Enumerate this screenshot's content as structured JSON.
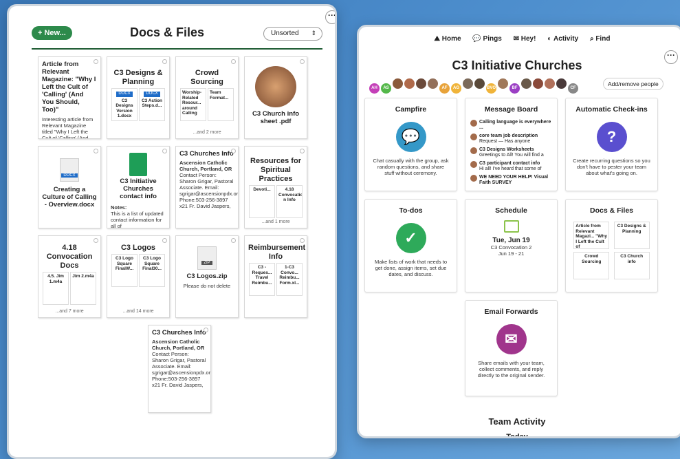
{
  "docs": {
    "new_label": "+ New...",
    "title": "Docs & Files",
    "sort": "Unsorted",
    "c1": {
      "title": "Article from Relevant Magazine: \"Why I Left the Cult of 'Calling' (And You Should, Too)\"",
      "body": "Interesting article from Relevant Magazine titled \"Why I Left the Cult of 'Calling' (And You",
      "badge": "1"
    },
    "c2": {
      "title": "C3 Designs & Planning",
      "m1": "C3 Designs Version 1.docx",
      "m2": "C3 Action Steps.d..."
    },
    "c3": {
      "title": "Crowd Sourcing",
      "m1": "Worship-Related Resour... around Calling",
      "m2": "Team Format...",
      "m3": "Storyte...",
      "m4": "Small",
      "more": "...and 2 more"
    },
    "c4": {
      "title": "C3 Church info sheet .pdf"
    },
    "c5": {
      "title": "Creating a Culture of Calling - Overview.docx",
      "docx": "DOCX"
    },
    "c6": {
      "title": "C3 Initiative Churches contact info",
      "notes": "Notes:",
      "body": "This is a list of updated contact information for all of"
    },
    "c7": {
      "title": "C3 Churches Info",
      "h": "Ascension Catholic Church, Portland, OR",
      "body": "Contact Person: Sharon Grigar, Pastoral Associate. Email: sgrigar@ascensionpdx.org Phone:503-256-3897 x21 Fr. David Jaspers,"
    },
    "c8": {
      "title": "Resources for Spiritual Practices",
      "m1": "Devoti...",
      "m2": "4.18 Convocatio n Info",
      "more": "...and 1 more"
    },
    "c9": {
      "title": "4.18 Convocation Docs",
      "m1": "4.5. Jim 1.m4a",
      "m2": "Jim 2.m4a",
      "more": "...and 7 more"
    },
    "c10": {
      "title": "C3 Logos",
      "m1": "C3 Logo Square FinalW...",
      "m2": "C3 Logo Square Final30...",
      "more": "...and 14 more"
    },
    "c11": {
      "title": "C3 Logos.zip",
      "zip": "ZIP",
      "body": "Please do not delete"
    },
    "c12": {
      "title": "Reimbursement Info",
      "m1": "C3 - Reques... Travel Reimbu...",
      "m2": "1-C3 Convo... Reimbu... Form.xl..."
    },
    "c13": {
      "title": "C3 Churches Info",
      "h": "Ascension Catholic Church, Portland, OR",
      "body": "Contact Person: Sharon Grigar, Pastoral Associate. Email: sgrigar@ascensionpdx.org Phone:503-256-3897 x21 Fr. David Jaspers,"
    }
  },
  "nav": {
    "home": "Home",
    "pings": "Pings",
    "hey": "Hey!",
    "activity": "Activity",
    "find": "Find",
    "hey_count": "1"
  },
  "project": {
    "title": "C3 Initiative Churches",
    "add": "Add/remove people",
    "avatars": [
      {
        "t": "AH",
        "c": "#c43fb8"
      },
      {
        "t": "AS",
        "c": "#54b84a"
      },
      {
        "t": "",
        "c": "#8a5a3b"
      },
      {
        "t": "",
        "c": "#b06a4a"
      },
      {
        "t": "",
        "c": "#6b4a3a"
      },
      {
        "t": "",
        "c": "#93705a"
      },
      {
        "t": "AF",
        "c": "#e8a33a"
      },
      {
        "t": "AG",
        "c": "#f0b43a"
      },
      {
        "t": "",
        "c": "#7b6a5a"
      },
      {
        "t": "",
        "c": "#5a4a3a"
      },
      {
        "t": "BVO",
        "c": "#f0b43a"
      },
      {
        "t": "",
        "c": "#a0785a"
      },
      {
        "t": "BF",
        "c": "#9b3fc4"
      },
      {
        "t": "",
        "c": "#6a5a4a"
      },
      {
        "t": "",
        "c": "#8a4a3a"
      },
      {
        "t": "",
        "c": "#b0705a"
      },
      {
        "t": "",
        "c": "#4a3a3a"
      },
      {
        "t": "CF",
        "c": "#888"
      }
    ]
  },
  "tools": {
    "campfire": {
      "title": "Campfire",
      "desc": "Chat casually with the group, ask random questions, and share stuff without ceremony."
    },
    "board": {
      "title": "Message Board",
      "m": [
        {
          "t": "Calling language is everywhere ...",
          "s": ""
        },
        {
          "t": "core team job description",
          "s": "Request — Has anyone"
        },
        {
          "t": "C3 Designs Worksheets",
          "s": "Greetings to All! You will find a"
        },
        {
          "t": "C3 participant contact info",
          "s": "Hi all! I've heard that some of"
        },
        {
          "t": "WE NEED YOUR HELP! Visual Faith SURVEY",
          "s": ""
        }
      ]
    },
    "checkins": {
      "title": "Automatic Check-ins",
      "desc": "Create recurring questions so you don't have to pester your team about what's going on."
    },
    "todos": {
      "title": "To-dos",
      "desc": "Make lists of work that needs to get done, assign items, set due dates, and discuss."
    },
    "schedule": {
      "title": "Schedule",
      "date": "Tue, Jun 19",
      "event": "C3 Convocation 2",
      "range": "Jun 19 - 21"
    },
    "docs": {
      "title": "Docs & Files",
      "m1": "Article from Relevant Magazi... \"Why I Left the Cult of",
      "m2": "C3 Designs & Planning",
      "m3": "Crowd Sourcing",
      "m4": "C3 Church info"
    },
    "email": {
      "title": "Email Forwards",
      "desc": "Share emails with your team, collect comments, and reply directly to the original sender."
    }
  },
  "activity": {
    "title": "Team Activity",
    "today": "Today"
  }
}
